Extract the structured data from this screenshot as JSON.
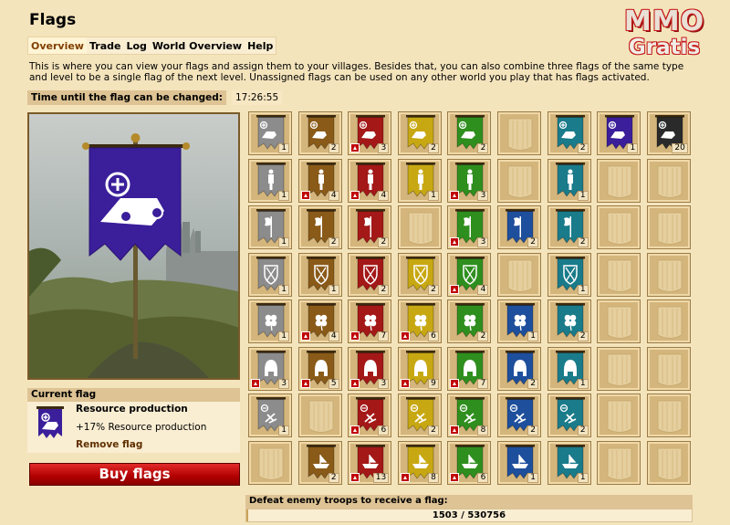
{
  "page": {
    "title": "Flags"
  },
  "logo": {
    "line1": "MMO",
    "line2": "Gratis"
  },
  "tabs": [
    {
      "label": "Overview",
      "active": true
    },
    {
      "label": "Trade",
      "active": false
    },
    {
      "label": "Log",
      "active": false
    },
    {
      "label": "World Overview",
      "active": false
    },
    {
      "label": "Help",
      "active": false
    }
  ],
  "intro": "This is where you can view your flags and assign them to your villages. Besides that, you can also combine three flags of the same type and level to be a single flag of the next level. Unassigned flags can be used on any other world you play that has flags activated.",
  "timer": {
    "label": "Time until the flag can be changed:",
    "value": "17:26:55"
  },
  "current_flag": {
    "heading": "Current flag",
    "name": "Resource production",
    "effect": "+17% Resource production",
    "remove_label": "Remove flag",
    "color": "#3a1e9a",
    "icon": "resource-icon"
  },
  "buy_button": {
    "label": "Buy flags"
  },
  "level_colors": [
    "#8c8c8c",
    "#8a5a18",
    "#a41818",
    "#c8a812",
    "#2f8f1e",
    "#1e4f9c",
    "#1a7b8a",
    "#3a1e9a",
    "#2a2a2a"
  ],
  "flag_rows": [
    {
      "type": "resource",
      "icon": "resource-icon",
      "cells": [
        {
          "count": "1",
          "upgrade": false
        },
        {
          "count": "2",
          "upgrade": false
        },
        {
          "count": "3",
          "upgrade": true
        },
        {
          "count": "2",
          "upgrade": false
        },
        {
          "count": "2",
          "upgrade": false
        },
        null,
        {
          "count": "2",
          "upgrade": false
        },
        {
          "count": "1",
          "upgrade": false
        },
        {
          "count": "20",
          "upgrade": false
        }
      ]
    },
    {
      "type": "recruitment",
      "icon": "soldier-icon",
      "cells": [
        {
          "count": "1",
          "upgrade": false
        },
        {
          "count": "4",
          "upgrade": true
        },
        {
          "count": "4",
          "upgrade": true
        },
        {
          "count": "1",
          "upgrade": false
        },
        {
          "count": "3",
          "upgrade": true
        },
        null,
        {
          "count": "1",
          "upgrade": false
        },
        null,
        null
      ]
    },
    {
      "type": "attack",
      "icon": "axe-icon",
      "cells": [
        {
          "count": "1",
          "upgrade": false
        },
        {
          "count": "2",
          "upgrade": false
        },
        {
          "count": "2",
          "upgrade": false
        },
        null,
        {
          "count": "3",
          "upgrade": true
        },
        {
          "count": "2",
          "upgrade": false
        },
        {
          "count": "2",
          "upgrade": false
        },
        null,
        null
      ]
    },
    {
      "type": "defense",
      "icon": "shield-icon",
      "cells": [
        {
          "count": "1",
          "upgrade": false
        },
        {
          "count": "1",
          "upgrade": false
        },
        {
          "count": "2",
          "upgrade": false
        },
        {
          "count": "2",
          "upgrade": false
        },
        {
          "count": "4",
          "upgrade": true
        },
        null,
        {
          "count": "1",
          "upgrade": false
        },
        null,
        null
      ]
    },
    {
      "type": "luck",
      "icon": "clover-icon",
      "cells": [
        {
          "count": "1",
          "upgrade": false
        },
        {
          "count": "4",
          "upgrade": true
        },
        {
          "count": "7",
          "upgrade": true
        },
        {
          "count": "6",
          "upgrade": true
        },
        {
          "count": "2",
          "upgrade": false
        },
        {
          "count": "1",
          "upgrade": false
        },
        {
          "count": "2",
          "upgrade": false
        },
        null,
        null
      ]
    },
    {
      "type": "population",
      "icon": "helmet-icon",
      "cells": [
        {
          "count": "3",
          "upgrade": true
        },
        {
          "count": "5",
          "upgrade": true
        },
        {
          "count": "3",
          "upgrade": true
        },
        {
          "count": "9",
          "upgrade": true
        },
        {
          "count": "7",
          "upgrade": true
        },
        {
          "count": "2",
          "upgrade": false
        },
        {
          "count": "1",
          "upgrade": false
        },
        null,
        null
      ]
    },
    {
      "type": "coin-cost",
      "icon": "coin-icon",
      "cells": [
        {
          "count": "1",
          "upgrade": false
        },
        null,
        {
          "count": "6",
          "upgrade": true
        },
        {
          "count": "2",
          "upgrade": false
        },
        {
          "count": "8",
          "upgrade": true
        },
        {
          "count": "2",
          "upgrade": false
        },
        {
          "count": "2",
          "upgrade": false
        },
        null,
        null
      ]
    },
    {
      "type": "haul",
      "icon": "ship-icon",
      "cells": [
        null,
        {
          "count": "2",
          "upgrade": false
        },
        {
          "count": "13",
          "upgrade": true
        },
        {
          "count": "8",
          "upgrade": true
        },
        {
          "count": "6",
          "upgrade": true
        },
        {
          "count": "1",
          "upgrade": false
        },
        {
          "count": "1",
          "upgrade": false
        },
        null,
        null
      ]
    }
  ],
  "defeat": {
    "label": "Defeat enemy troops to receive a flag:",
    "progress_text": "1503 / 530756",
    "current": 1503,
    "target": 530756
  }
}
